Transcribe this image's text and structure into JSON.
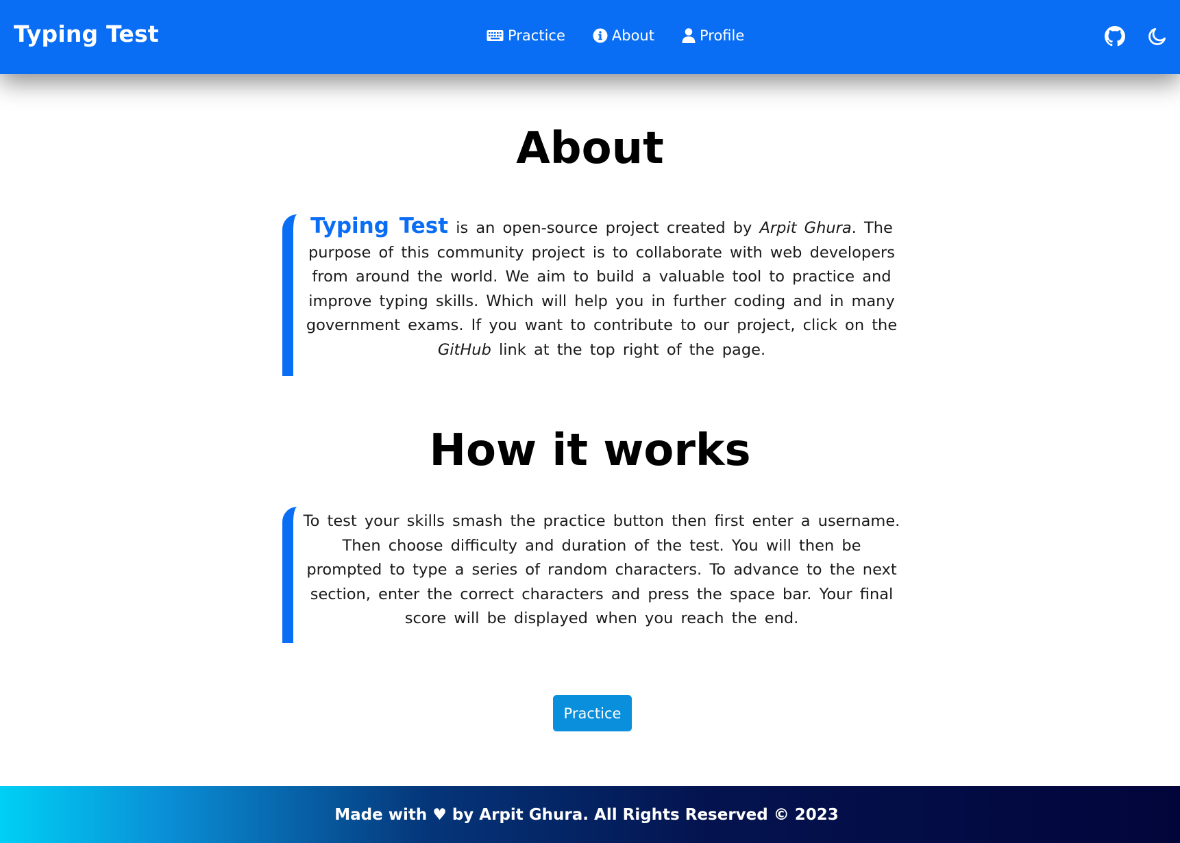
{
  "navbar": {
    "brand": "Typing Test",
    "links": [
      {
        "label": "Practice",
        "icon": "keyboard-icon"
      },
      {
        "label": "About",
        "icon": "info-circle-icon"
      },
      {
        "label": "Profile",
        "icon": "user-icon"
      }
    ],
    "right_icons": [
      "github-icon",
      "moon-icon"
    ]
  },
  "about": {
    "title": "About",
    "highlight": "Typing Test",
    "text_1": " is an open-source project created by ",
    "author": "Arpit Ghura",
    "text_2": ". The purpose of this community project is to collaborate with web developers from around the world. We aim to build a valuable tool to practice and improve typing skills. Which will help you in further coding and in many government exams. If you want to contribute to our project, click on the ",
    "link_word": "GitHub",
    "text_3": " link at the top right of the page."
  },
  "how_it_works": {
    "title": "How it works",
    "text": "To test your skills smash the practice button then first enter a username. Then choose difficulty and duration of the test. You will then be prompted to type a series of random characters. To advance to the next section, enter the correct characters and press the space bar. Your final score will be displayed when you reach the end."
  },
  "practice_button": "Practice",
  "footer": {
    "text": "Made with ♥ by Arpit Ghura. All Rights Reserved © 2023"
  },
  "colors": {
    "primary": "#0a6ef5",
    "button": "#0a8fdc",
    "footer_gradient_start": "#00d0f5",
    "footer_gradient_end": "#02053a"
  }
}
